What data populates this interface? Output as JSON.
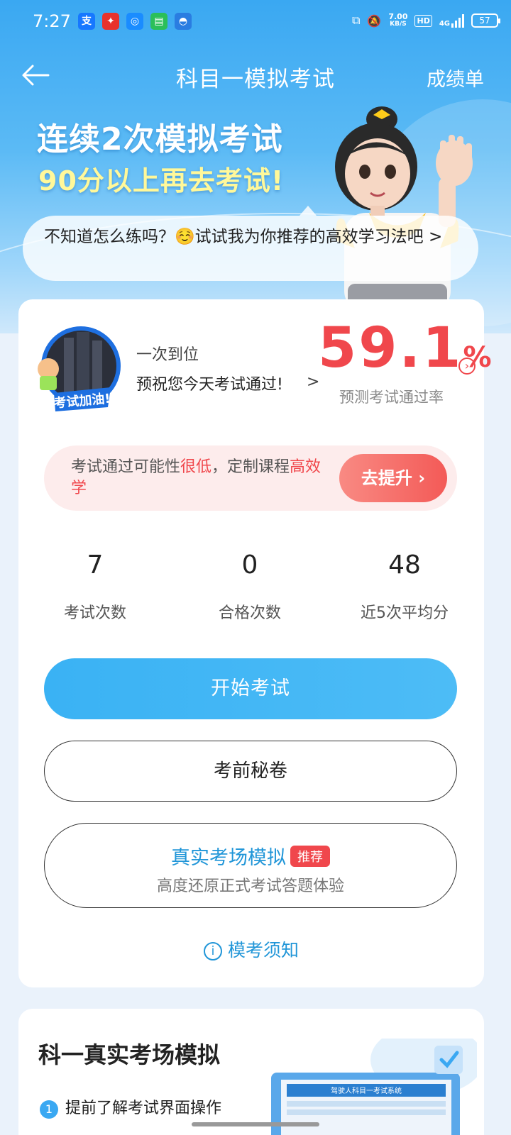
{
  "status_bar": {
    "time": "7:27",
    "net_speed_value": "7.00",
    "net_speed_unit": "KB/S",
    "hd_label": "HD",
    "network_label": "4G",
    "battery_level": "57"
  },
  "nav": {
    "title": "科目一模拟考试",
    "right_label": "成绩单"
  },
  "hero": {
    "line1": "连续2次模拟考试",
    "line2": "90分以上再去考试!",
    "tip": "不知道怎么练吗？☺️试试我为你推荐的高效学习法吧 >"
  },
  "badge": {
    "image_text": "考试加油!"
  },
  "summary": {
    "level_name": "一次到位",
    "wish": "预祝您今天考试通过!",
    "pass_rate_value": "59.1",
    "pass_rate_unit": "%",
    "pass_rate_label": "预测考试通过率"
  },
  "warning": {
    "text_part1": "考试通过可能性",
    "text_red1": "很低",
    "text_part2": "，定制课程",
    "text_red2": "高效学",
    "button_label": "去提升"
  },
  "stats": [
    {
      "value": "7",
      "label": "考试次数"
    },
    {
      "value": "0",
      "label": "合格次数"
    },
    {
      "value": "48",
      "label": "近5次平均分"
    }
  ],
  "buttons": {
    "start": "开始考试",
    "secret": "考前秘卷",
    "real_title": "真实考场模拟",
    "real_badge": "推荐",
    "real_subtitle": "高度还原正式考试答题体验",
    "notice": "模考须知"
  },
  "section2": {
    "title": "科一真实考场模拟",
    "step1_num": "1",
    "step1_text": "提前了解考试界面操作",
    "preview_banner": "驾驶人科目一考试系统"
  },
  "colors": {
    "accent_blue": "#3ab2f4",
    "danger_red": "#f0474c",
    "link_blue": "#2196d8"
  }
}
